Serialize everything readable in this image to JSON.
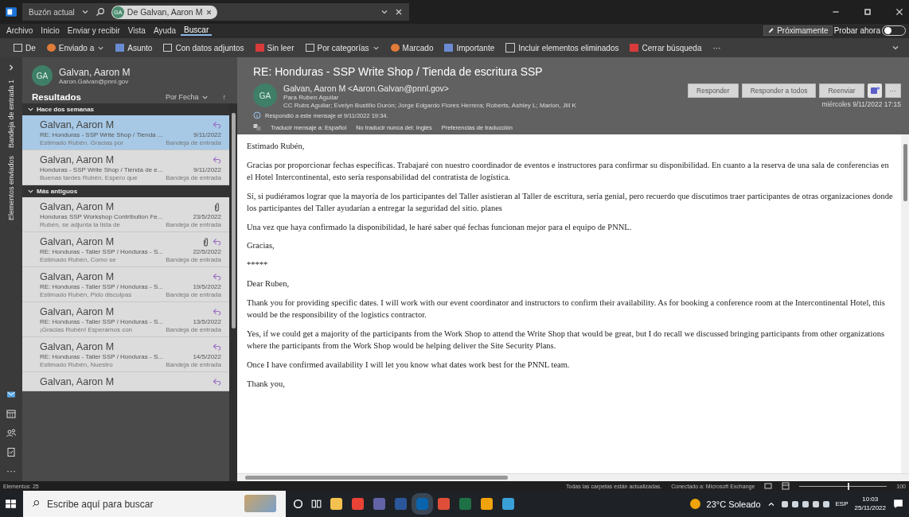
{
  "title_bar": {
    "scope": "Buzón actual",
    "search_chip": {
      "initials": "GA",
      "label": "De Galvan, Aaron M"
    }
  },
  "menu": {
    "tabs": [
      {
        "label": "Archivo",
        "selected": false
      },
      {
        "label": "Inicio",
        "selected": false
      },
      {
        "label": "Enviar y recibir",
        "selected": false
      },
      {
        "label": "Vista",
        "selected": false
      },
      {
        "label": "Ayuda",
        "selected": false
      },
      {
        "label": "Buscar",
        "selected": true
      }
    ],
    "coming_soon": "Próximamente",
    "try_now": {
      "label": "Probar ahora",
      "on": false
    }
  },
  "ribbon": {
    "items": [
      {
        "label": "De",
        "kind": "button"
      },
      {
        "label": "Enviado a",
        "kind": "dropdown"
      },
      {
        "label": "Asunto",
        "kind": "button"
      },
      {
        "label": "Con datos adjuntos",
        "kind": "button"
      },
      {
        "label": "Sin leer",
        "kind": "button"
      },
      {
        "label": "Por categorías",
        "kind": "dropdown"
      },
      {
        "label": "Marcado",
        "kind": "button"
      },
      {
        "label": "Importante",
        "kind": "button"
      },
      {
        "label": "Incluir elementos eliminados",
        "kind": "checkbox",
        "checked": false
      },
      {
        "label": "Cerrar búsqueda",
        "kind": "button"
      },
      {
        "label": "···",
        "kind": "more"
      }
    ]
  },
  "side_rail": {
    "folders": [
      "Bandeja de entrada 1",
      "Elementos enviados"
    ],
    "more": "···"
  },
  "account": {
    "initials": "GA",
    "name": "Galvan, Aaron M",
    "email": "Aaron.Galvan@pnnl.gov"
  },
  "results": {
    "title": "Resultados",
    "sort": "Por Fecha",
    "direction": "↑",
    "groups": [
      {
        "label": "Hace dos semanas",
        "messages": [
          {
            "sender": "Galvan, Aaron M",
            "subject": "RE: Honduras - SSP Write Shop / Tienda ...",
            "date": "9/11/2022",
            "preview": "Estimado Rubén. Gracias por",
            "folder": "Bandeja de entrada",
            "replied": true,
            "attachment": false,
            "selected": true
          },
          {
            "sender": "Galvan, Aaron M",
            "subject": "Honduras - SSP Write Shop / Tienda de e...",
            "date": "9/11/2022",
            "preview": "Buenas tardes Rubén. Espero que",
            "folder": "Bandeja de entrada",
            "replied": true,
            "attachment": false,
            "selected": false
          }
        ]
      },
      {
        "label": "Más antiguos",
        "messages": [
          {
            "sender": "Galvan, Aaron M",
            "subject": "Honduras SSP Workshop Contribution Fe...",
            "date": "23/5/2022",
            "preview": "Rubén, se adjunta la lista de",
            "folder": "Bandeja de entrada",
            "replied": false,
            "attachment": true,
            "selected": false
          },
          {
            "sender": "Galvan, Aaron M",
            "subject": "RE: Honduras - Taller SSP / Honduras - S...",
            "date": "22/5/2022",
            "preview": "Estimado Rubén, Como se",
            "folder": "Bandeja de entrada",
            "replied": true,
            "attachment": true,
            "selected": false
          },
          {
            "sender": "Galvan, Aaron M",
            "subject": "RE: Honduras - Taller SSP / Honduras - S...",
            "date": "19/5/2022",
            "preview": "Estimado Rubén, Pido disculpas",
            "folder": "Bandeja de entrada",
            "replied": true,
            "attachment": false,
            "selected": false
          },
          {
            "sender": "Galvan, Aaron M",
            "subject": "RE: Honduras - Taller SSP / Honduras - S...",
            "date": "13/5/2022",
            "preview": "¡Gracias Rubén! Esperamos con",
            "folder": "Bandeja de entrada",
            "replied": true,
            "attachment": false,
            "selected": false
          },
          {
            "sender": "Galvan, Aaron M",
            "subject": "RE: Honduras - Taller SSP / Honduras - S...",
            "date": "14/5/2022",
            "preview": "Estimado Rubén, Nuestro",
            "folder": "Bandeja de entrada",
            "replied": true,
            "attachment": false,
            "selected": false
          },
          {
            "sender": "Galvan, Aaron M",
            "replied": true,
            "attachment": false,
            "selected": false
          }
        ]
      }
    ]
  },
  "message": {
    "subject": "RE: Honduras - SSP Write Shop / Tienda de escritura SSP",
    "initials": "GA",
    "from": "Galvan, Aaron M <Aaron.Galvan@pnnl.gov>",
    "to_label": "Para",
    "to": "Ruben Aguilar",
    "cc_label": "CC",
    "cc": "Rubs Aguilar; Evelyn Bustillo Durón; Jorge Edgardo Flores Herrera; Roberts, Ashley L; Marion, Jill K",
    "info": "Respondió a este mensaje el 9/11/2022 19:34.",
    "translate": [
      "Traducir mensaje a: Español",
      "No traducir nunca del: Inglés",
      "Preferencias de traducción"
    ],
    "actions": [
      "Responder",
      "Responder a todos",
      "Reenviar"
    ],
    "more": "···",
    "date": "miércoles 9/11/2022 17:15",
    "body": [
      "Estimado Rubén,",
      "Gracias por proporcionar fechas específicas. Trabajaré con nuestro coordinador de eventos e instructores para confirmar su disponibilidad. En cuanto a la reserva de una sala de conferencias en el Hotel Intercontinental, esto sería responsabilidad del contratista de logística.",
      "Sí, si pudiéramos lograr que la mayoría de los participantes del Taller asistieran al Taller de escritura, sería genial, pero recuerdo que discutimos traer participantes de otras organizaciones donde los participantes del Taller ayudarían a entregar la seguridad del sitio. planes",
      "Una vez que haya confirmado la disponibilidad, le haré saber qué fechas funcionan mejor para el equipo de PNNL.",
      "Gracias,",
      "*****",
      "Dear Ruben,",
      "Thank you for providing specific dates. I will work with our event coordinator and instructors to confirm their availability. As for booking a conference room at the Intercontinental Hotel, this would be the responsibility of the logistics contractor.",
      "Yes, if we could get a majority of the participants from the Work Shop to attend the Write Shop that would be great, but I do recall we discussed bringing participants from other organizations where the participants from the Work Shop would be helping deliver the Site Security Plans.",
      "Once I have confirmed availability I will let you know what dates work best for the PNNL team.",
      "Thank you,"
    ]
  },
  "status_bar": {
    "items": "Elementos: 25",
    "sync": "Todas las carpetas están actualizadas.",
    "connection": "Conectado a: Microsoft Exchange",
    "zoom": "100",
    "zoom_slider": {
      "level": 0.55
    }
  },
  "taskbar": {
    "search_placeholder": "Escribe aquí para buscar",
    "weather": "23°C Soleado",
    "language": "ESP",
    "time": "10:03",
    "date": "25/11/2022"
  }
}
